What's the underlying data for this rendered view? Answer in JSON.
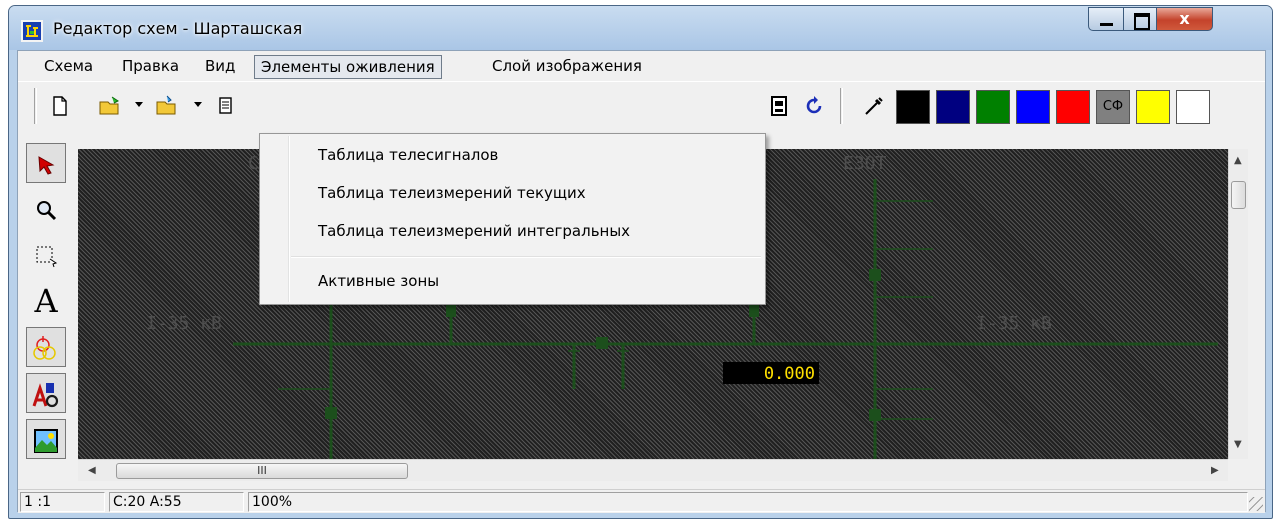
{
  "window": {
    "title": "Редактор схем - Шарташская",
    "close_label": "x"
  },
  "menu": [
    {
      "label": "Схема"
    },
    {
      "label": "Правка"
    },
    {
      "label": "Вид"
    },
    {
      "label": "Элементы оживления",
      "open": true
    },
    {
      "label": "Слой изображения"
    }
  ],
  "dropdown": {
    "items": [
      "Таблица телесигналов",
      "Таблица телеизмерений текущих",
      "Таблица телеизмерений интегральных",
      "Активные зоны"
    ]
  },
  "toolbar": {
    "colors": [
      "#000000",
      "#000080",
      "#008000",
      "#0000ff",
      "#ff0000",
      "#808080",
      "#ffff00",
      "#ffffff"
    ],
    "color_label_6": "СФ"
  },
  "canvas": {
    "section_left_label": "I-35 кВ",
    "section_right_label": "I-35 кВ",
    "top_label_left": "С",
    "top_label_right": "ЕЗОТ",
    "measurement_value": "0.000"
  },
  "status": {
    "scale": "1 :1",
    "coords": "C:20  A:55",
    "zoom": "100%"
  },
  "scrollbar": {
    "grip_text": "III"
  }
}
